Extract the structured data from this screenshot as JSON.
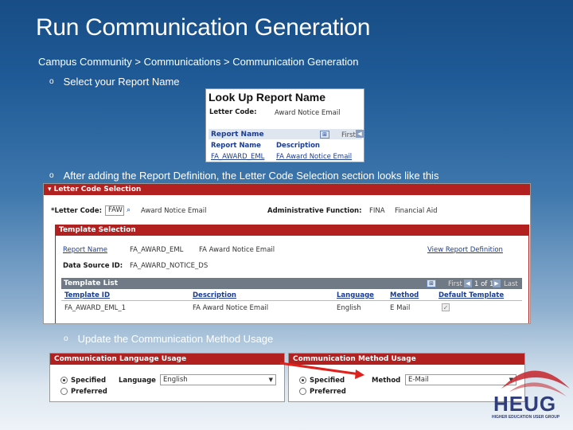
{
  "slide": {
    "title": "Run Communication Generation",
    "breadcrumb": "Campus Community > Communications > Communication Generation",
    "bullet1": "Select your Report Name",
    "bullet2": "After adding the Report Definition, the Letter Code Selection section looks like this",
    "bullet3": "Update the Communication Method Usage",
    "bullet_glyph": "o"
  },
  "lookup": {
    "title": "Look Up Report Name",
    "letter_code_label": "Letter Code:",
    "letter_code_value": "Award Notice Email",
    "grid_title": "Report Name",
    "first_label": "First",
    "col_report_name": "Report Name",
    "col_description": "Description",
    "row_report_name": "FA_AWARD_EML",
    "row_description": "FA Award Notice Email"
  },
  "letter_code_selection": {
    "header": "Letter Code Selection",
    "letter_code_label": "*Letter Code:",
    "letter_code_value": "FAW",
    "letter_code_desc": "Award Notice Email",
    "admin_function_label": "Administrative Function:",
    "admin_function_code": "FINA",
    "admin_function_desc": "Financial Aid",
    "template_header": "Template Selection",
    "report_name_label": "Report Name",
    "report_name_value": "FA_AWARD_EML",
    "report_name_desc": "FA Award Notice Email",
    "view_report_def_link": "View Report Definition",
    "data_source_label": "Data Source ID:",
    "data_source_value": "FA_AWARD_NOTICE_DS",
    "template_list_title": "Template List",
    "first_label": "First",
    "pager_text": "1 of 1",
    "last_label": "Last",
    "columns": [
      "Template ID",
      "Description",
      "Language",
      "Method",
      "Default Template"
    ],
    "row": {
      "template_id": "FA_AWARD_EML_1",
      "description": "FA Award Notice Email",
      "language": "English",
      "method": "E Mail",
      "default_template": "✓"
    }
  },
  "lang_usage": {
    "header": "Communication Language Usage",
    "specified_label": "Specified",
    "preferred_label": "Preferred",
    "language_label": "Language",
    "language_value": "English"
  },
  "method_usage": {
    "header": "Communication Method Usage",
    "specified_label": "Specified",
    "preferred_label": "Preferred",
    "method_label": "Method",
    "method_value": "E-Mail"
  },
  "logo": {
    "text": "HEUG",
    "subtext": "HIGHER EDUCATION USER GROUP",
    "color": "#2f3d7a",
    "accent": "#c5252b"
  },
  "colors": {
    "ps_red": "#b32020",
    "ps_grid": "#6f7a86",
    "link_blue": "#1c3c8f",
    "annotation_red": "#e0201c"
  }
}
